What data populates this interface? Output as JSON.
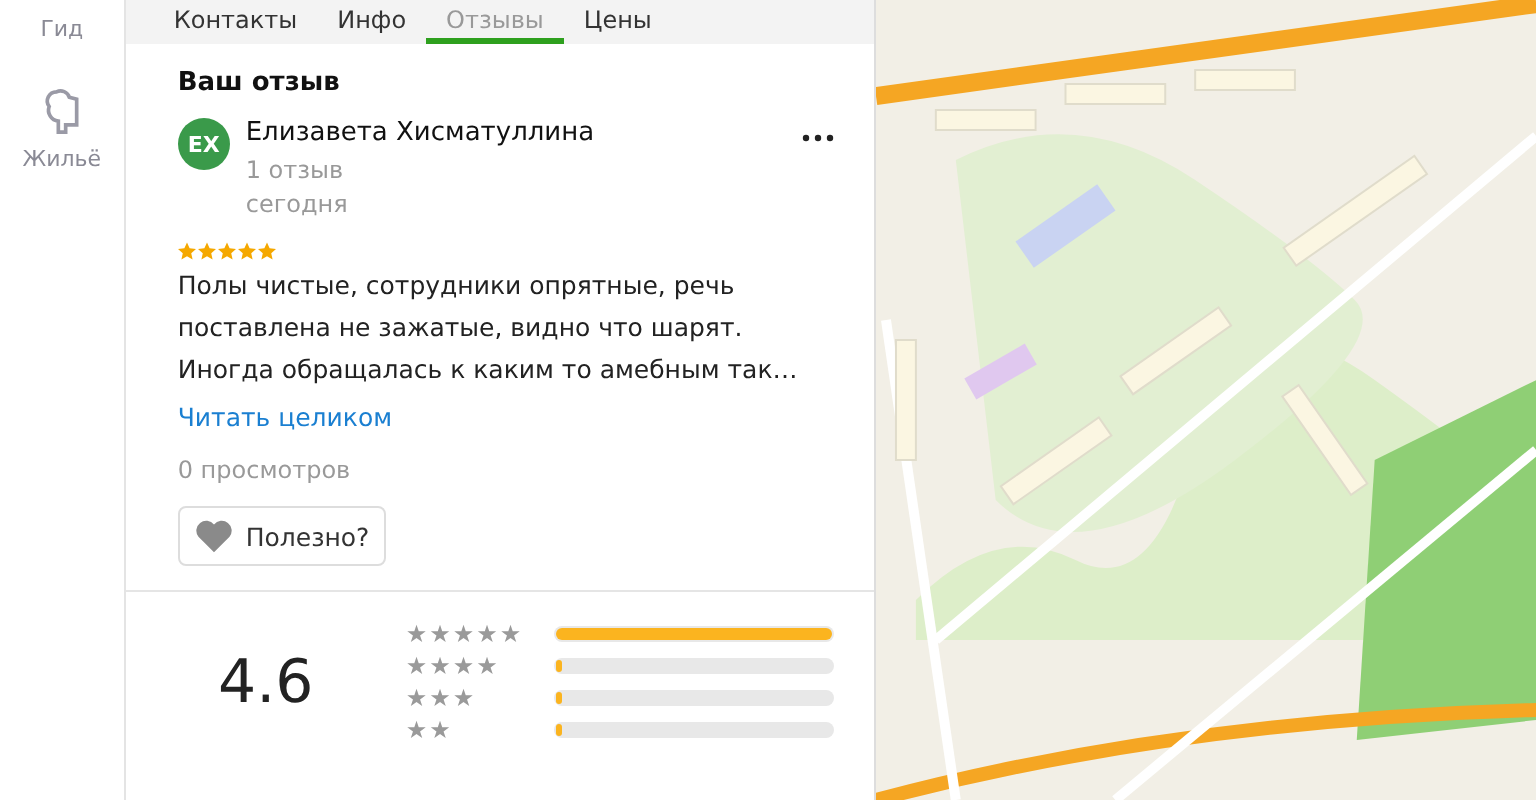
{
  "sidebar": {
    "items": [
      {
        "label": "Гид",
        "kind": "guide"
      },
      {
        "label": "Жильё",
        "kind": "housing"
      }
    ]
  },
  "tabs": [
    {
      "label": "Контакты",
      "selected": false
    },
    {
      "label": "Инфо",
      "selected": false
    },
    {
      "label": "Отзывы",
      "selected": true
    },
    {
      "label": "Цены",
      "selected": false
    }
  ],
  "my_review": {
    "heading": "Ваш отзыв",
    "avatar_initials": "EX",
    "author": "Елизавета Хисматуллина",
    "author_reviews": "1 отзыв",
    "date": "сегодня",
    "stars": 5,
    "text": "Полы чистые, сотрудники опрятные, речь поставлена не зажатые, видно что шарят. Иногда обращалась к каким то амебным так…",
    "read_more": "Читать целиком",
    "views": "0 просмотров",
    "helpful_button": "Полезно?"
  },
  "rating": {
    "value": "4.6",
    "distribution": [
      {
        "label": "★★★★★",
        "level": 1.0
      },
      {
        "label": "★★★★",
        "level": 0.02
      },
      {
        "label": "★★★",
        "level": 0.02
      },
      {
        "label": "★★",
        "level": 0.02
      }
    ]
  }
}
